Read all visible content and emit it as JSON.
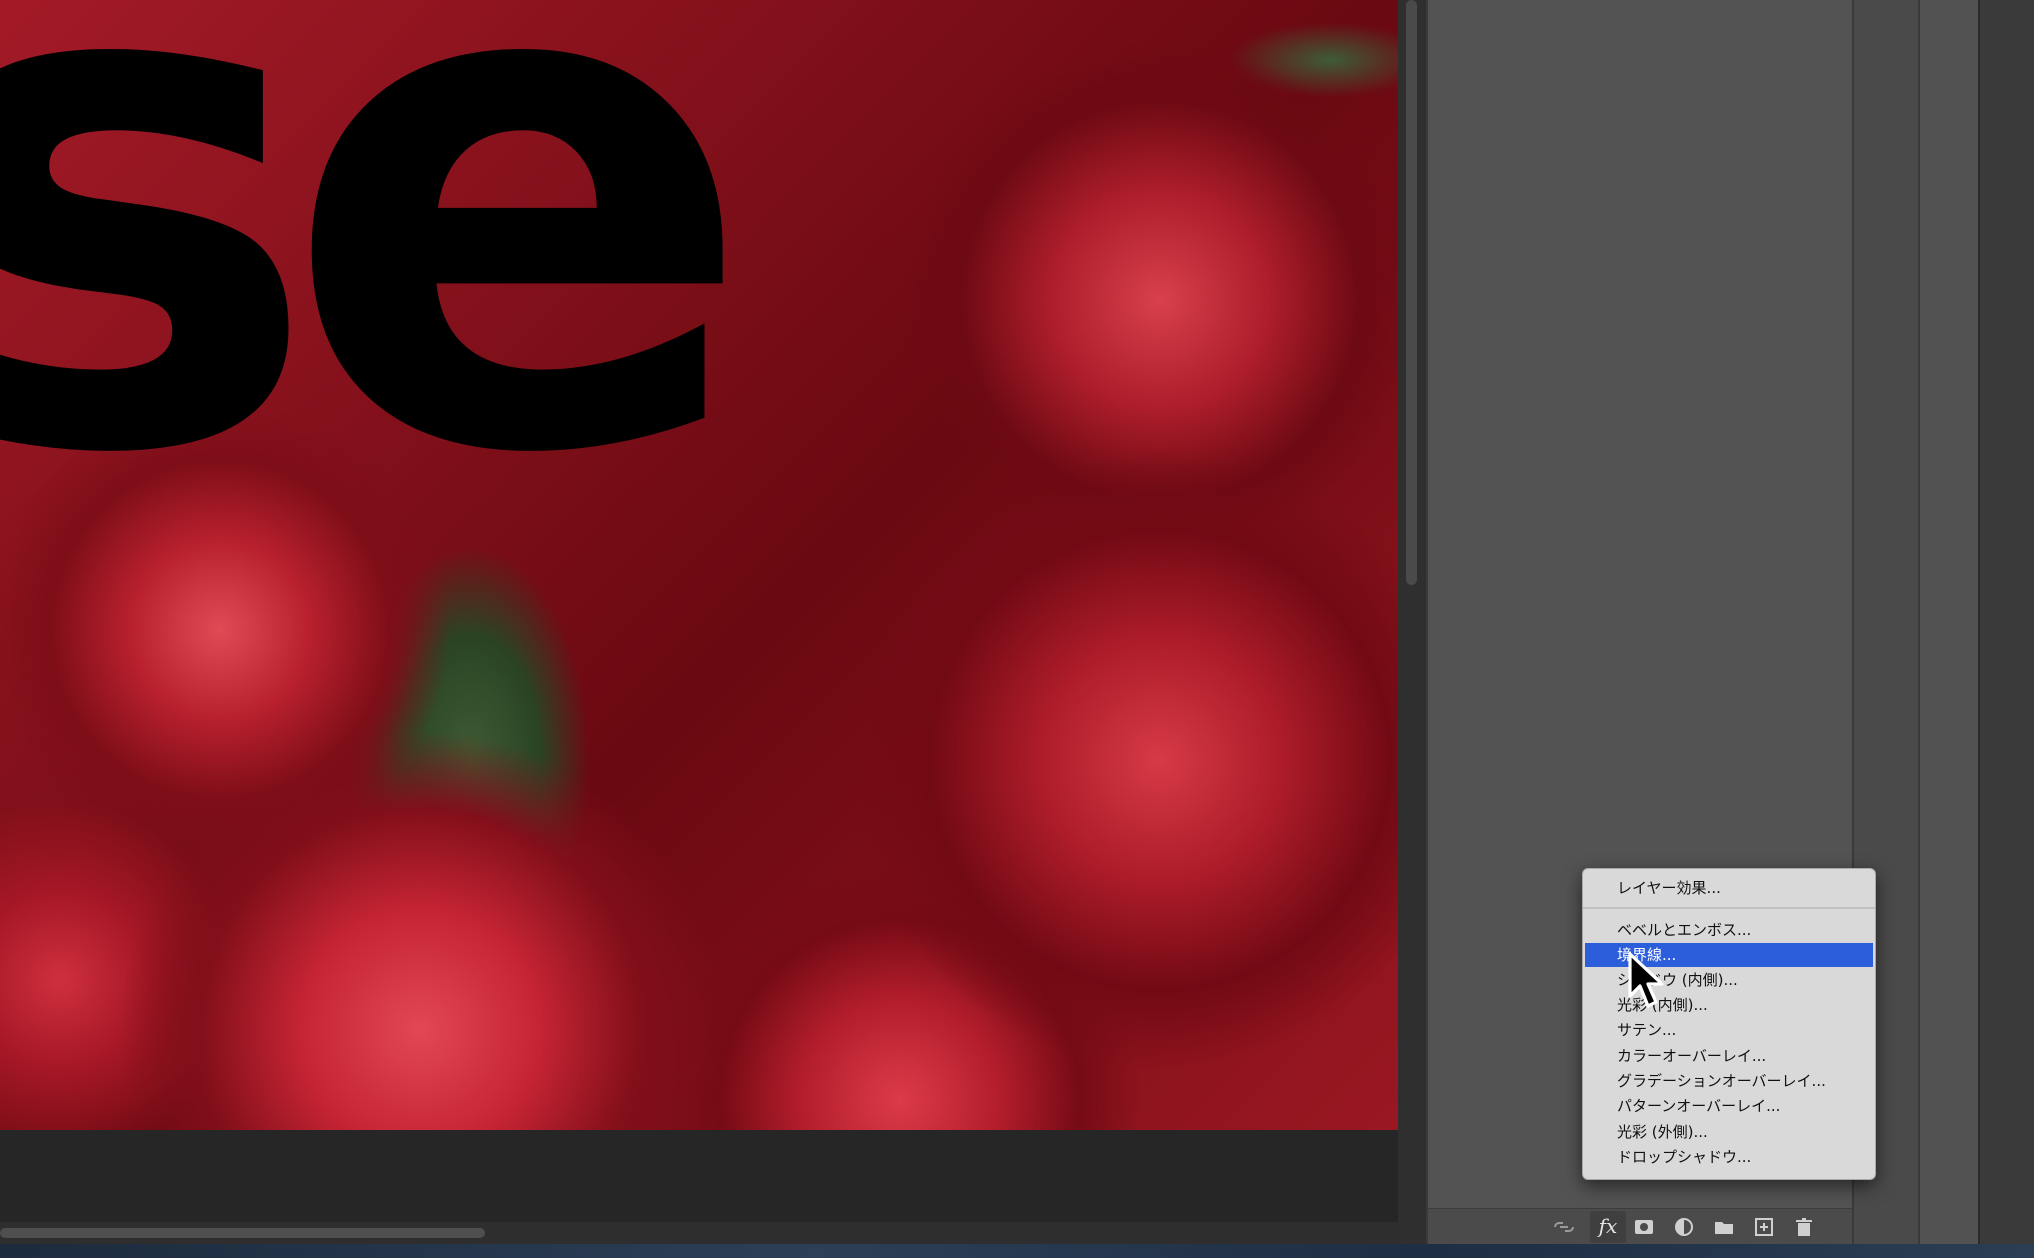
{
  "document": {
    "canvas_text": "se"
  },
  "fx_menu": {
    "items": [
      {
        "label": "レイヤー効果..."
      },
      {
        "label": "ベベルとエンボス..."
      },
      {
        "label": "境界線..."
      },
      {
        "label": "シャドウ (内側)..."
      },
      {
        "label": "光彩 (内側)..."
      },
      {
        "label": "サテン..."
      },
      {
        "label": "カラーオーバーレイ..."
      },
      {
        "label": "グラデーションオーバーレイ..."
      },
      {
        "label": "パターンオーバーレイ..."
      },
      {
        "label": "光彩 (外側)..."
      },
      {
        "label": "ドロップシャドウ..."
      }
    ],
    "selected_index": 2
  },
  "layers_footer": {
    "fx_label": "fx",
    "icons": [
      "link-layers-icon",
      "fx-icon",
      "add-mask-icon",
      "adjustment-layer-icon",
      "new-group-icon",
      "new-layer-icon",
      "trash-icon"
    ]
  },
  "colors": {
    "menu_highlight": "#2c5ddb",
    "panel_bg": "#535353",
    "menu_bg": "#d9d9d9"
  }
}
